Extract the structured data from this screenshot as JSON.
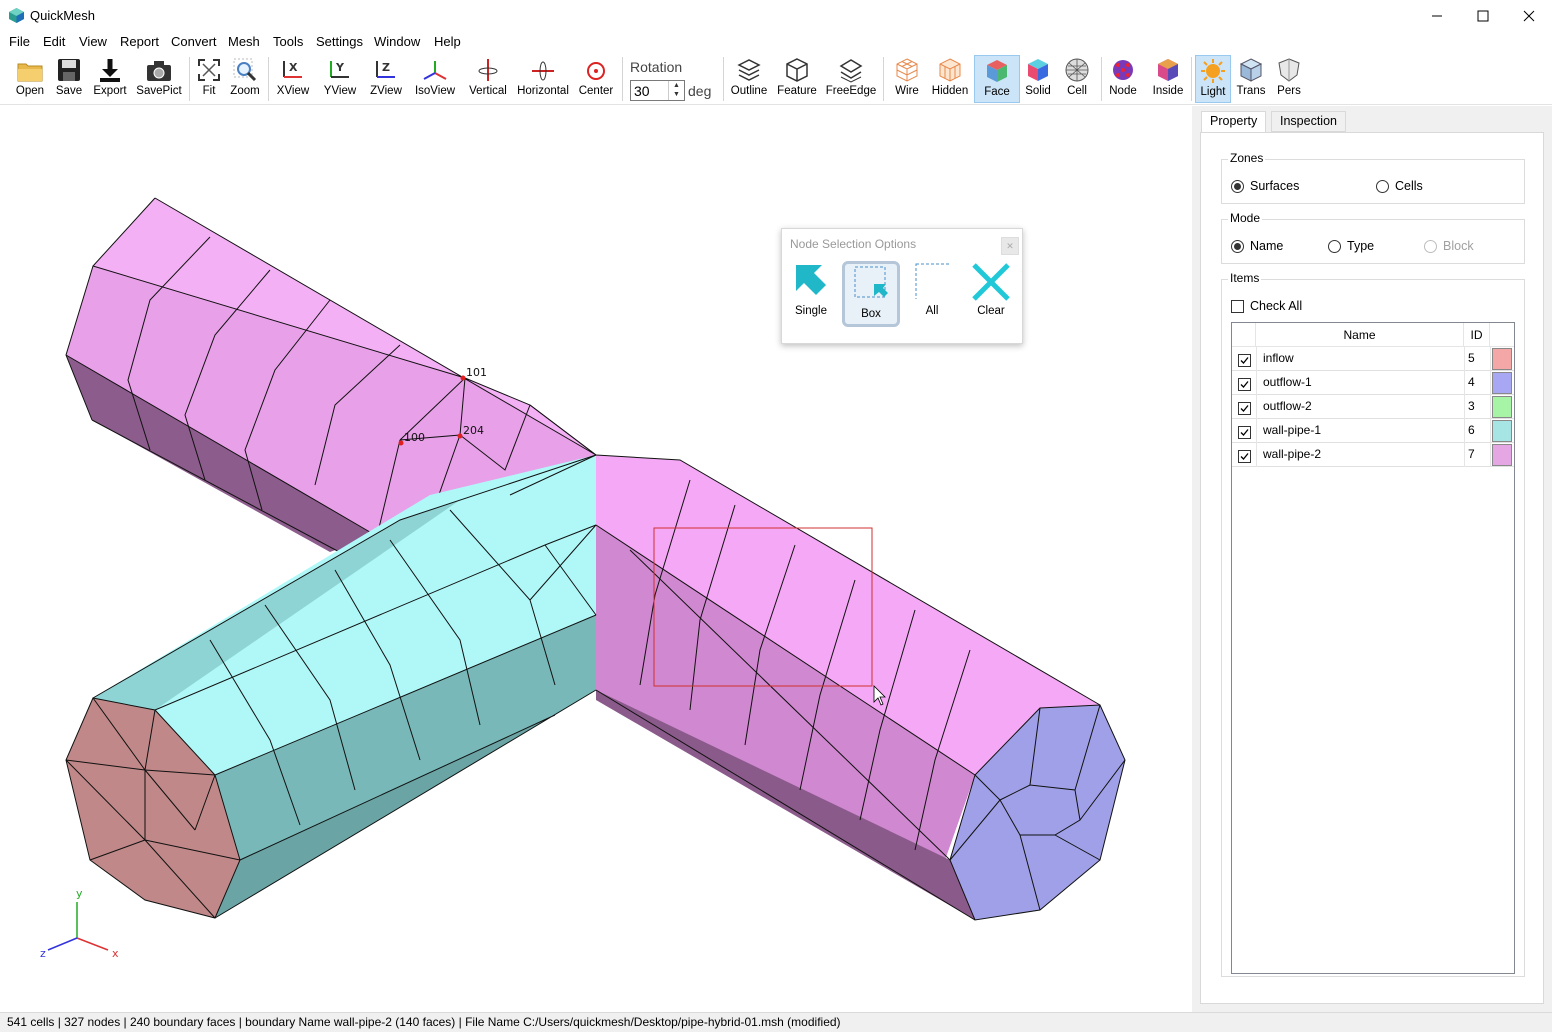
{
  "window": {
    "title": "QuickMesh"
  },
  "menu": [
    "File",
    "Edit",
    "View",
    "Report",
    "Convert",
    "Mesh",
    "Tools",
    "Settings",
    "Window",
    "Help"
  ],
  "toolbar": {
    "file_buttons": [
      "Open",
      "Save",
      "Export",
      "SavePict"
    ],
    "view_buttons": [
      "Fit",
      "Zoom"
    ],
    "axis_buttons": [
      "XView",
      "YView",
      "ZView",
      "IsoView",
      "Vertical",
      "Horizontal",
      "Center"
    ],
    "rotation_label": "Rotation",
    "rotation_value": "30",
    "rotation_unit": "deg",
    "display_buttons": [
      "Outline",
      "Feature",
      "FreeEdge"
    ],
    "render_buttons": [
      "Wire",
      "Hidden",
      "Face",
      "Solid",
      "Cell"
    ],
    "node_buttons": [
      "Node",
      "Inside"
    ],
    "light_buttons": [
      "Light",
      "Trans",
      "Pers"
    ],
    "active_buttons": [
      "Face",
      "Light"
    ]
  },
  "popup": {
    "title": "Node Selection Options",
    "buttons": [
      "Single",
      "Box",
      "All",
      "Clear"
    ],
    "active": "Box"
  },
  "viewport": {
    "node_labels": [
      "101",
      "100",
      "204"
    ],
    "axis_labels": {
      "y": "y",
      "z": "z",
      "x": "x"
    }
  },
  "panel": {
    "tabs": [
      "Property",
      "Inspection"
    ],
    "active_tab": "Property",
    "zones": {
      "label": "Zones",
      "options": [
        "Surfaces",
        "Cells"
      ],
      "selected": "Surfaces"
    },
    "mode": {
      "label": "Mode",
      "options": [
        "Name",
        "Type",
        "Block"
      ],
      "selected": "Name",
      "disabled": "Block"
    },
    "items": {
      "label": "Items",
      "check_all": "Check All",
      "columns": [
        "Name",
        "ID"
      ],
      "rows": [
        {
          "name": "inflow",
          "id": "5",
          "color": "#f4a7a7",
          "checked": true
        },
        {
          "name": "outflow-1",
          "id": "4",
          "color": "#a7a7f4",
          "checked": true
        },
        {
          "name": "outflow-2",
          "id": "3",
          "color": "#a7f4a7",
          "checked": true
        },
        {
          "name": "wall-pipe-1",
          "id": "6",
          "color": "#a7e4e4",
          "checked": true
        },
        {
          "name": "wall-pipe-2",
          "id": "7",
          "color": "#e4a7e4",
          "checked": true
        }
      ]
    }
  },
  "status": "541 cells | 327 nodes | 240 boundary faces |  boundary Name wall-pipe-2 (140 faces) | File Name C:/Users/quickmesh/Desktop/pipe-hybrid-01.msh (modified)"
}
